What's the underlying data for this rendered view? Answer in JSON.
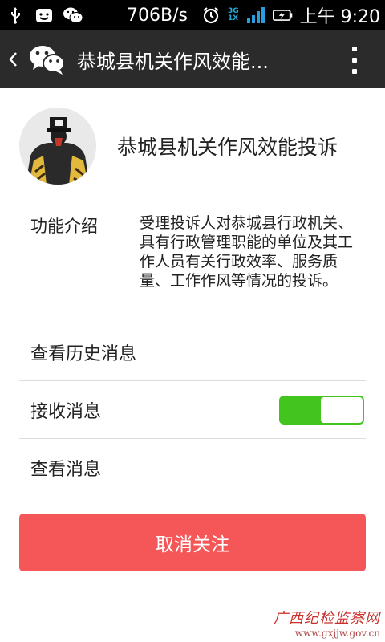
{
  "status_bar": {
    "net_speed": "706B/s",
    "network_3g": "3G",
    "network_1x": "1X",
    "time": "上午 9:20",
    "icons": [
      "usb-icon",
      "smile-icon",
      "wechat-icon",
      "alarm-icon",
      "signal-icon",
      "battery-charging-icon"
    ]
  },
  "action_bar": {
    "title": "恭城县机关作风效能..."
  },
  "profile": {
    "name": "恭城县机关作风效能投诉"
  },
  "intro": {
    "label": "功能介绍",
    "text": "受理投诉人对恭城县行政机关、具有行政管理职能的单位及其工作人员有关行政效率、服务质量、工作作风等情况的投诉。"
  },
  "rows": {
    "history": "查看历史消息",
    "receive": "接收消息",
    "view": "查看消息"
  },
  "receive_toggle": {
    "on": true
  },
  "unfollow_button": "取消关注",
  "watermark": {
    "title": "广西纪检监察网",
    "url": "www.gxjjw.gov.cn"
  },
  "colors": {
    "action_bar": "#2b2b2b",
    "toggle_on": "#44c41e",
    "unfollow": "#f55758"
  }
}
